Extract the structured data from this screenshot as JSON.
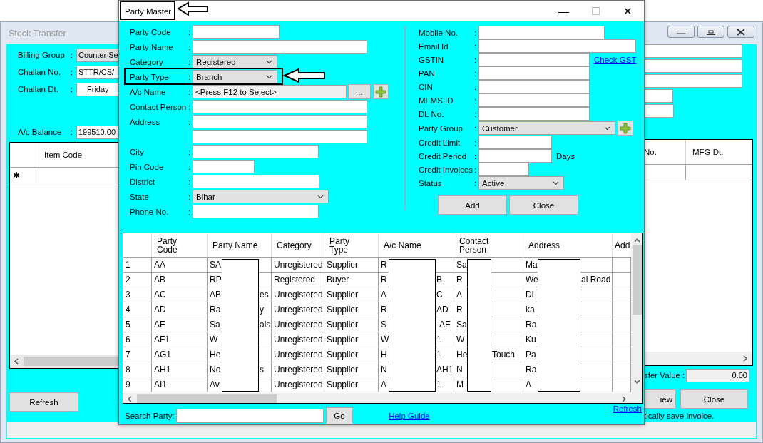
{
  "background_window": {
    "title": "Stock Transfer",
    "fields": [
      {
        "label": "Billing Group",
        "colon": ":",
        "value": "Counter Se",
        "kind": "combo"
      },
      {
        "label": "Challan No.",
        "colon": ":",
        "value": "STTR/CS/",
        "kind": "text"
      },
      {
        "label": "Challan Dt.",
        "colon": ":",
        "value": "Friday",
        "kind": "date"
      },
      {
        "label": "A/c Balance",
        "colon": ":",
        "value": "199510.00",
        "kind": "text"
      }
    ],
    "grid": {
      "columns": [
        "Item Code"
      ],
      "row_marker": "✱"
    },
    "right_grid": {
      "columns": [
        "No.",
        "MFG Dt."
      ]
    },
    "value_label": "sfer Value :",
    "value": "0.00",
    "buttons_left": [
      "Refresh"
    ],
    "buttons_right": [
      "iew",
      "Close"
    ],
    "note": "tically save invoice."
  },
  "dialog": {
    "title": "Party Master",
    "controls": [
      "—",
      "☐",
      "✕"
    ],
    "left_fields": [
      {
        "label": "Party Code",
        "colon": ":",
        "kind": "text"
      },
      {
        "label": "Party Name",
        "colon": ":",
        "kind": "text"
      },
      {
        "label": "Category",
        "colon": ":",
        "kind": "combo",
        "value": "Registered"
      },
      {
        "label": "Party Type",
        "colon": ":",
        "kind": "combo",
        "value": "Branch",
        "highlighted": true
      },
      {
        "label": "A/c Name",
        "colon": ":",
        "kind": "lookup",
        "value": "<Press F12 to Select>",
        "browse": "..."
      },
      {
        "label": "Contact Person",
        "colon": ":",
        "kind": "text"
      },
      {
        "label": "Address",
        "colon": ":",
        "kind": "text"
      },
      {
        "kind": "text"
      },
      {
        "label": "City",
        "colon": ":",
        "kind": "text"
      },
      {
        "label": "Pin Code",
        "colon": ":",
        "kind": "text"
      },
      {
        "label": "District",
        "colon": ":",
        "kind": "text"
      },
      {
        "label": "State",
        "colon": ":",
        "kind": "combo",
        "value": "Bihar"
      },
      {
        "label": "Phone No.",
        "colon": ":",
        "kind": "text"
      }
    ],
    "right_fields": [
      {
        "label": "Mobile No.",
        "colon": ":",
        "kind": "text"
      },
      {
        "label": "Email Id",
        "colon": ":",
        "kind": "text"
      },
      {
        "label": "GSTIN",
        "colon": ":",
        "kind": "text",
        "link": "Check GST"
      },
      {
        "label": "PAN",
        "colon": ":",
        "kind": "text"
      },
      {
        "label": "CIN",
        "colon": ":",
        "kind": "text"
      },
      {
        "label": "MFMS ID",
        "colon": ":",
        "kind": "text"
      },
      {
        "label": "DL No.",
        "colon": ":",
        "kind": "text"
      },
      {
        "label": "Party Group",
        "colon": ":",
        "kind": "combo",
        "value": "Customer",
        "add_button": true
      },
      {
        "label": "Credit Limit",
        "colon": ":",
        "kind": "text"
      },
      {
        "label": "Credit Period",
        "colon": ":",
        "kind": "text",
        "suffix": "Days"
      },
      {
        "label": "Credit Invoices",
        "colon": ":",
        "kind": "text"
      },
      {
        "label": "Status",
        "colon": ":",
        "kind": "combo",
        "value": "Active"
      }
    ],
    "buttons": [
      "Add",
      "Close"
    ],
    "table": {
      "columns": [
        "",
        "Party Code",
        "Party Name",
        "Category",
        "Party Type",
        "A/c Name",
        "Contact Person",
        "Address",
        "Add"
      ],
      "rows": [
        {
          "cells": [
            "1",
            "AA",
            "SA",
            "Unregistered",
            "Supplier",
            "R",
            "Sa",
            "Ma"
          ]
        },
        {
          "cells": [
            "2",
            "AB",
            "RP",
            "Registered",
            "Buyer",
            "R",
            "R",
            "We"
          ],
          "tails": {
            "ac_name": "B",
            "address": "al Road"
          }
        },
        {
          "cells": [
            "3",
            "AC",
            "AB",
            "Unregistered",
            "Supplier",
            "A",
            "A",
            "Di"
          ],
          "tails": {
            "party_name": "es",
            "ac_name": "C"
          }
        },
        {
          "cells": [
            "4",
            "AD",
            "Ra",
            "Unregistered",
            "Supplier",
            "R",
            "R",
            "ka"
          ],
          "tails": {
            "party_name": "y",
            "ac_name": "AD"
          }
        },
        {
          "cells": [
            "5",
            "AE",
            "Sa",
            "Unregistered",
            "Supplier",
            "S",
            "Sa",
            "Ra"
          ],
          "tails": {
            "party_name": "als",
            "ac_name": "-AE"
          }
        },
        {
          "cells": [
            "6",
            "AF1",
            "W",
            "Unregistered",
            "Supplier",
            "W",
            "W",
            "Ku"
          ],
          "tails": {
            "ac_name": "1"
          }
        },
        {
          "cells": [
            "7",
            "AG1",
            "He",
            "Unregistered",
            "Supplier",
            "H",
            "He",
            "Pa"
          ],
          "tails": {
            "ac_name": "1",
            "contact_person": "Touch"
          }
        },
        {
          "cells": [
            "8",
            "AH1",
            "No",
            "Unregistered",
            "Supplier",
            "N",
            "N",
            "Ra"
          ],
          "tails": {
            "party_name": "s",
            "ac_name": "AH1"
          }
        },
        {
          "cells": [
            "9",
            "AI1",
            "Av",
            "Unregistered",
            "Supplier",
            "A",
            "M",
            "A"
          ],
          "tails": {
            "ac_name": "1"
          }
        }
      ]
    },
    "search": {
      "label": "Search Party:",
      "button": "Go"
    },
    "links": [
      "Help Guide",
      "Refresh"
    ]
  }
}
